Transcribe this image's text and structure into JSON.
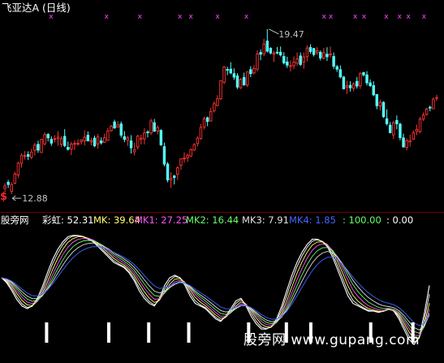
{
  "window": {
    "title": "飞亚达A (日线)"
  },
  "price_pane": {
    "high_label": "19.47",
    "low_label": "12.88",
    "buy_signal": "$",
    "signal_mark": "x",
    "colors": {
      "up_candle": "#ff3333",
      "down_candle": "#54ffff",
      "signal_mark": "#ff44ff",
      "arrow_text": "#c0c0c0"
    },
    "price_range": [
      12.5,
      20.0
    ],
    "candles": [
      [
        13.15,
        13.36,
        13.0,
        13.25
      ],
      [
        13.4,
        13.49,
        13.17,
        13.31
      ],
      [
        13.03,
        13.39,
        12.92,
        13.31
      ],
      [
        13.36,
        13.82,
        13.32,
        13.73
      ],
      [
        13.69,
        14.22,
        13.57,
        14.17
      ],
      [
        14.16,
        14.56,
        13.99,
        14.48
      ],
      [
        14.47,
        14.65,
        14.31,
        14.47
      ],
      [
        14.51,
        14.64,
        14.29,
        14.44
      ],
      [
        14.4,
        14.74,
        14.32,
        14.61
      ],
      [
        14.68,
        14.99,
        14.47,
        14.89
      ],
      [
        14.92,
        15.07,
        14.58,
        14.69
      ],
      [
        14.59,
        15.15,
        14.59,
        15.12
      ],
      [
        14.94,
        15.41,
        14.88,
        15.31
      ],
      [
        15.32,
        15.37,
        15.04,
        15.18
      ],
      [
        15.12,
        15.24,
        14.86,
        14.97
      ],
      [
        15.15,
        15.29,
        15.0,
        15.15
      ],
      [
        15.15,
        15.45,
        14.87,
        15.21
      ],
      [
        14.92,
        15.25,
        14.81,
        15.15
      ],
      [
        15.24,
        15.53,
        14.81,
        14.87
      ],
      [
        14.8,
        15.03,
        14.67,
        14.72
      ],
      [
        14.73,
        15.03,
        14.49,
        14.93
      ],
      [
        14.96,
        15.08,
        14.69,
        14.96
      ],
      [
        14.96,
        15.13,
        14.86,
        14.96
      ],
      [
        15.03,
        15.12,
        14.91,
        15.1
      ],
      [
        15.06,
        15.48,
        14.87,
        15.21
      ],
      [
        15.29,
        15.44,
        15.05,
        15.06
      ],
      [
        15.02,
        15.19,
        14.88,
        15.07
      ],
      [
        15.17,
        15.27,
        14.81,
        14.86
      ],
      [
        14.94,
        15.34,
        14.75,
        15.22
      ],
      [
        15.06,
        15.2,
        14.91,
        14.98
      ],
      [
        15.0,
        15.35,
        14.98,
        15.19
      ],
      [
        15.08,
        15.58,
        15.07,
        15.46
      ],
      [
        15.47,
        15.71,
        15.43,
        15.65
      ],
      [
        15.82,
        15.91,
        15.54,
        15.58
      ],
      [
        15.61,
        15.85,
        15.6,
        15.7
      ],
      [
        15.74,
        15.84,
        15.19,
        15.29
      ],
      [
        15.23,
        15.45,
        15.01,
        15.12
      ],
      [
        15.08,
        15.26,
        14.86,
        15.18
      ],
      [
        15.06,
        15.29,
        14.55,
        14.78
      ],
      [
        14.62,
        14.98,
        14.48,
        14.71
      ],
      [
        14.82,
        15.31,
        14.72,
        15.25
      ],
      [
        15.13,
        15.31,
        14.92,
        15.17
      ],
      [
        15.14,
        15.57,
        14.92,
        15.38
      ],
      [
        15.42,
        15.49,
        15.2,
        15.4
      ],
      [
        15.38,
        15.95,
        15.29,
        15.86
      ],
      [
        15.79,
        15.94,
        15.42,
        15.45
      ],
      [
        15.45,
        15.68,
        15.32,
        15.6
      ],
      [
        15.48,
        15.53,
        14.86,
        14.9
      ],
      [
        14.83,
        14.99,
        14.04,
        14.13
      ],
      [
        14.13,
        14.21,
        13.4,
        13.49
      ],
      [
        13.49,
        13.8,
        13.17,
        13.56
      ],
      [
        13.65,
        13.7,
        13.31,
        13.59
      ],
      [
        13.72,
        14.04,
        13.49,
        13.98
      ],
      [
        14.08,
        14.35,
        13.89,
        14.34
      ],
      [
        14.34,
        14.6,
        14.19,
        14.37
      ],
      [
        14.38,
        14.56,
        14.22,
        14.48
      ],
      [
        14.45,
        14.76,
        14.41,
        14.71
      ],
      [
        14.69,
        14.97,
        14.65,
        14.91
      ],
      [
        14.95,
        15.25,
        14.84,
        15.17
      ],
      [
        15.16,
        15.74,
        15.11,
        15.6
      ],
      [
        15.62,
        16.03,
        15.52,
        15.95
      ],
      [
        15.99,
        16.03,
        15.65,
        15.84
      ],
      [
        15.86,
        16.39,
        15.84,
        16.24
      ],
      [
        16.27,
        16.65,
        16.2,
        16.55
      ],
      [
        16.48,
        16.9,
        16.44,
        16.75
      ],
      [
        16.75,
        17.48,
        16.7,
        17.48
      ],
      [
        17.41,
        18.07,
        17.34,
        18.03
      ],
      [
        17.93,
        18.04,
        17.7,
        17.91
      ],
      [
        17.94,
        18.22,
        17.73,
        17.79
      ],
      [
        17.76,
        17.97,
        17.51,
        17.62
      ],
      [
        17.67,
        17.78,
        17.14,
        17.22
      ],
      [
        17.19,
        17.58,
        17.15,
        17.53
      ],
      [
        17.61,
        17.8,
        17.27,
        17.31
      ],
      [
        17.3,
        17.84,
        17.22,
        17.84
      ],
      [
        17.92,
        18.06,
        17.62,
        17.76
      ],
      [
        17.79,
        18.1,
        17.73,
        17.96
      ],
      [
        17.94,
        18.7,
        17.86,
        18.55
      ],
      [
        18.61,
        18.73,
        18.3,
        18.54
      ],
      [
        18.56,
        19.16,
        18.46,
        18.95
      ],
      [
        19.07,
        19.55,
        18.61,
        18.66
      ],
      [
        18.78,
        18.82,
        18.53,
        18.59
      ],
      [
        18.54,
        18.68,
        18.23,
        18.59
      ],
      [
        18.62,
        18.83,
        18.54,
        18.61
      ],
      [
        18.62,
        18.85,
        18.45,
        18.51
      ],
      [
        18.45,
        18.62,
        18.13,
        18.19
      ],
      [
        18.23,
        18.44,
        17.99,
        18.1
      ],
      [
        18.07,
        18.29,
        17.85,
        18.08
      ],
      [
        18.08,
        18.45,
        17.94,
        18.22
      ],
      [
        18.18,
        18.61,
        18.07,
        18.35
      ],
      [
        18.47,
        18.61,
        18.07,
        18.13
      ],
      [
        18.23,
        18.61,
        17.96,
        18.43
      ],
      [
        18.44,
        18.9,
        18.25,
        18.79
      ],
      [
        18.81,
        18.94,
        18.56,
        18.65
      ],
      [
        18.77,
        18.79,
        18.45,
        18.53
      ],
      [
        18.6,
        18.83,
        18.51,
        18.68
      ],
      [
        18.62,
        18.69,
        18.29,
        18.39
      ],
      [
        18.38,
        18.79,
        18.33,
        18.6
      ],
      [
        18.54,
        18.82,
        18.27,
        18.44
      ],
      [
        18.51,
        18.85,
        18.41,
        18.55
      ],
      [
        18.45,
        18.61,
        17.95,
        18.06
      ],
      [
        18.04,
        18.11,
        17.83,
        17.94
      ],
      [
        17.92,
        18.09,
        17.57,
        17.63
      ],
      [
        17.63,
        17.65,
        17.13,
        17.15
      ],
      [
        17.21,
        17.48,
        16.95,
        17.28
      ],
      [
        17.29,
        17.46,
        17.04,
        17.19
      ],
      [
        17.17,
        17.41,
        17.05,
        17.34
      ],
      [
        17.45,
        17.63,
        17.16,
        17.26
      ],
      [
        17.27,
        17.83,
        17.15,
        17.76
      ],
      [
        17.8,
        17.84,
        17.65,
        17.71
      ],
      [
        17.71,
        17.86,
        17.28,
        17.39
      ],
      [
        17.39,
        17.53,
        17.22,
        17.28
      ],
      [
        17.28,
        17.46,
        16.85,
        16.91
      ],
      [
        16.92,
        16.92,
        16.33,
        16.47
      ],
      [
        16.46,
        16.72,
        16.28,
        16.61
      ],
      [
        16.61,
        16.65,
        15.98,
        16.03
      ],
      [
        15.95,
        16.33,
        15.68,
        15.75
      ],
      [
        15.69,
        15.82,
        15.36,
        15.39
      ],
      [
        15.3,
        15.86,
        15.14,
        15.79
      ],
      [
        15.88,
        16.08,
        15.53,
        15.75
      ],
      [
        15.73,
        15.79,
        15.08,
        15.19
      ],
      [
        15.18,
        15.35,
        14.78,
        14.82
      ],
      [
        14.8,
        15.16,
        14.68,
        15.07
      ],
      [
        15.02,
        15.31,
        14.83,
        15.07
      ],
      [
        15.13,
        15.48,
        15.1,
        15.38
      ],
      [
        15.44,
        15.71,
        15.29,
        15.52
      ],
      [
        15.43,
        16.02,
        15.37,
        15.93
      ],
      [
        15.93,
        16.2,
        15.86,
        16.1
      ],
      [
        16.12,
        16.39,
        16.08,
        16.34
      ],
      [
        16.41,
        16.48,
        16.25,
        16.38
      ],
      [
        16.35,
        16.81,
        16.33,
        16.73
      ],
      [
        16.77,
        16.91,
        16.66,
        16.8
      ]
    ],
    "signal_positions": [
      0.115,
      0.24,
      0.315,
      0.405,
      0.43,
      0.49,
      0.555,
      0.73,
      0.745,
      0.8,
      0.82,
      0.87,
      0.9,
      0.92,
      0.955
    ]
  },
  "indicator": {
    "title": "股旁网",
    "name": "彩虹",
    "values": [
      {
        "label": "彩虹: 52.31",
        "color": "#ffffff"
      },
      {
        "label": "MK: 39.64",
        "color": "#ffff66"
      },
      {
        "label": "MK1: 27.25",
        "color": "#ff55ff"
      },
      {
        "label": "MK2: 16.44",
        "color": "#66ff66"
      },
      {
        "label": "MK3: 7.91",
        "color": "#e0e0e0"
      },
      {
        "label": "MK4: 1.85",
        "color": "#4466ff"
      },
      {
        "label": ": 100.00",
        "color": "#66ff66"
      },
      {
        "label": ": 0.00",
        "color": "#ffffff"
      }
    ],
    "line_colors": [
      "#ffffff",
      "#ffffff",
      "#ffff66",
      "#ff55ff",
      "#66ff66",
      "#e0e0e0",
      "#4466ff"
    ],
    "series_main": [
      62,
      58,
      52,
      45,
      40,
      38,
      40,
      46,
      55,
      66,
      76,
      84,
      90,
      94,
      95,
      95,
      94,
      92,
      90,
      86,
      82,
      78,
      74,
      72,
      70,
      66,
      60,
      52,
      46,
      42,
      40,
      46,
      56,
      62,
      64,
      62,
      56,
      48,
      42,
      40,
      38,
      34,
      30,
      28,
      32,
      38,
      44,
      46,
      40,
      32,
      26,
      22,
      22,
      24,
      30,
      40,
      52,
      64,
      74,
      82,
      88,
      92,
      92,
      90,
      86,
      78,
      68,
      58,
      48,
      42,
      40,
      38,
      36,
      36,
      35,
      36,
      38,
      36,
      30,
      22,
      14,
      10,
      16,
      34,
      56
    ],
    "bar_positions": [
      0.105,
      0.245,
      0.335,
      0.425,
      0.56,
      0.645,
      0.7,
      0.835,
      0.93
    ],
    "value_range": [
      0,
      100
    ]
  },
  "watermark": {
    "text": "股旁网 www.gupang.com"
  }
}
